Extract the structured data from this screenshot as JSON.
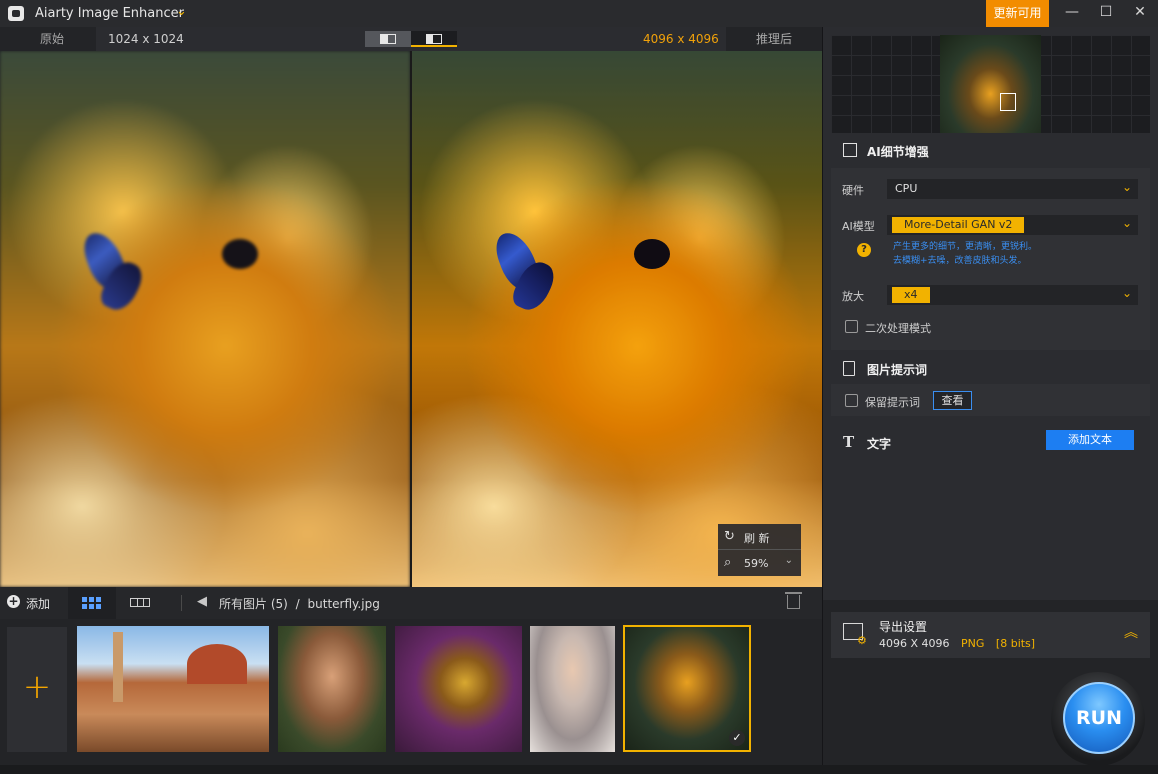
{
  "app": {
    "title": "Aiarty Image Enhancer",
    "update_label": "更新可用",
    "window_controls": [
      "minimize-icon",
      "maximize-icon",
      "close-icon"
    ]
  },
  "viewer": {
    "left_tab": "原始",
    "left_dim": "1024 x 1024",
    "right_dim": "4096 x 4096",
    "right_tab": "推理后",
    "refresh_label": "刷 新",
    "zoom_value": "59%"
  },
  "toolbar": {
    "add_label": "添加",
    "breadcrumb_all": "所有图片 (5)",
    "breadcrumb_sep": "/",
    "breadcrumb_file": "butterfly.jpg"
  },
  "thumbnails": [
    {
      "name": "florence-cathedral"
    },
    {
      "name": "woman-with-flowers"
    },
    {
      "name": "yellow-bird"
    },
    {
      "name": "bride-portrait"
    },
    {
      "name": "butterfly",
      "selected": true
    }
  ],
  "panel": {
    "ai_section_title": "AI细节增强",
    "hardware_label": "硬件",
    "hardware_value": "CPU",
    "model_label": "AI模型",
    "model_value": "More-Detail GAN v2",
    "model_desc_1": "产生更多的细节，更清晰，更锐利。",
    "model_desc_2": "去模糊+去噪，改善皮肤和头发。",
    "scale_label": "放大",
    "scale_value": "x4",
    "secondary_mode_label": "二次处理模式",
    "prompt_section_title": "图片提示词",
    "keep_prompt_label": "保留提示词",
    "view_label": "查看",
    "text_section_title": "文字",
    "add_text_label": "添加文本",
    "export_title": "导出设置",
    "export_size": "4096 X 4096",
    "export_format": "PNG",
    "export_bits": "[8 bits]",
    "run_label": "RUN"
  },
  "colors": {
    "accent": "#f2b200",
    "update": "#f28c00",
    "primary_blue": "#1d7ef2"
  }
}
